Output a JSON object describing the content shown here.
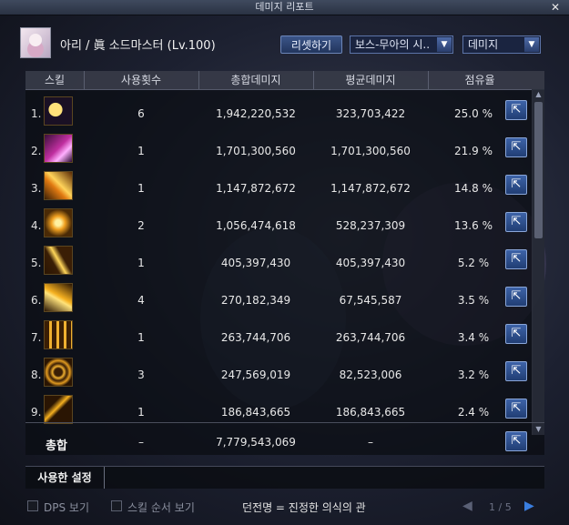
{
  "window": {
    "title": "데미지 리포트",
    "close_glyph": "✕"
  },
  "header": {
    "character": "아리 / 眞 소드마스터 (Lv.100)",
    "reset_label": "리셋하기",
    "boss_select": "보스-무아의 시..",
    "type_select": "데미지"
  },
  "table": {
    "columns": [
      "스킬",
      "사용횟수",
      "총합데미지",
      "평균데미지",
      "점유율"
    ],
    "rows": [
      {
        "rank": "1.",
        "uses": "6",
        "total": "1,942,220,532",
        "avg": "323,703,422",
        "share": "25.0 %",
        "icon": "crescent-moon-skill-icon"
      },
      {
        "rank": "2.",
        "uses": "1",
        "total": "1,701,300,560",
        "avg": "1,701,300,560",
        "share": "21.9 %",
        "icon": "pink-burst-skill-icon"
      },
      {
        "rank": "3.",
        "uses": "1",
        "total": "1,147,872,672",
        "avg": "1,147,872,672",
        "share": "14.8 %",
        "icon": "slash-flame-skill-icon"
      },
      {
        "rank": "4.",
        "uses": "2",
        "total": "1,056,474,618",
        "avg": "528,237,309",
        "share": "13.6 %",
        "icon": "golden-shatter-skill-icon"
      },
      {
        "rank": "5.",
        "uses": "1",
        "total": "405,397,430",
        "avg": "405,397,430",
        "share": "5.2 %",
        "icon": "diagonal-strike-skill-icon"
      },
      {
        "rank": "6.",
        "uses": "4",
        "total": "270,182,349",
        "avg": "67,545,587",
        "share": "3.5 %",
        "icon": "light-blade-skill-icon"
      },
      {
        "rank": "7.",
        "uses": "1",
        "total": "263,744,706",
        "avg": "263,744,706",
        "share": "3.4 %",
        "icon": "golden-rain-skill-icon"
      },
      {
        "rank": "8.",
        "uses": "3",
        "total": "247,569,019",
        "avg": "82,523,006",
        "share": "3.2 %",
        "icon": "spiral-slash-skill-icon"
      },
      {
        "rank": "9.",
        "uses": "1",
        "total": "186,843,665",
        "avg": "186,843,665",
        "share": "2.4 %",
        "icon": "cross-sword-skill-icon"
      }
    ],
    "total": {
      "label": "총합",
      "uses": "–",
      "total": "7,779,543,069",
      "avg": "–"
    }
  },
  "used_settings_label": "사용한 설정",
  "footer": {
    "dps_label": "DPS 보기",
    "skill_order_label": "스킬 순서 보기",
    "title_text": "던전명 = 진정한 의식의 관",
    "page": "1 / 5"
  },
  "colors": {
    "accent": "#3d63a8",
    "panel": "#0a0c12"
  }
}
